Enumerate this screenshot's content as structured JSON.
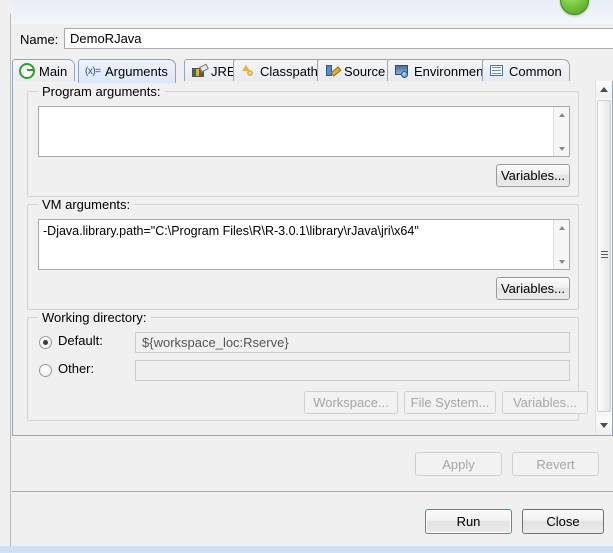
{
  "dialog": {
    "name_label": "Name:",
    "name_value": "DemoRJava"
  },
  "tabs": [
    {
      "label": "Main",
      "icon": "run-main-icon",
      "selected": false
    },
    {
      "label": "Arguments",
      "icon": "arguments-icon",
      "selected": true
    },
    {
      "label": "JRE",
      "icon": "jre-books-icon",
      "selected": false
    },
    {
      "label": "Classpath",
      "icon": "classpath-icon",
      "selected": false
    },
    {
      "label": "Source",
      "icon": "source-icon",
      "selected": false
    },
    {
      "label": "Environment",
      "icon": "environment-icon",
      "selected": false
    },
    {
      "label": "Common",
      "icon": "common-icon",
      "selected": false
    }
  ],
  "program_arguments": {
    "group_label": "Program arguments:",
    "value": "",
    "variables_button": "Variables..."
  },
  "vm_arguments": {
    "group_label": "VM arguments:",
    "value": "-Djava.library.path=\"C:\\Program Files\\R\\R-3.0.1\\library\\rJava\\jri\\x64\"",
    "variables_button": "Variables..."
  },
  "working_directory": {
    "group_label": "Working directory:",
    "default_label": "Default:",
    "default_selected": true,
    "default_value": "${workspace_loc:Rserve}",
    "other_label": "Other:",
    "other_selected": false,
    "other_value": "",
    "workspace_button": "Workspace...",
    "filesystem_button": "File System...",
    "variables_button": "Variables..."
  },
  "actions": {
    "apply": "Apply",
    "apply_enabled": false,
    "revert": "Revert",
    "revert_enabled": false,
    "run": "Run",
    "close": "Close"
  },
  "colors": {
    "dialog_bg": "#f0f0f0",
    "tab_border": "#96a5bb",
    "focus_blue": "#2196dd",
    "field_bg": "#ffffff",
    "disabled_text": "#a6a6a6",
    "accent_green": "#7ac943"
  }
}
